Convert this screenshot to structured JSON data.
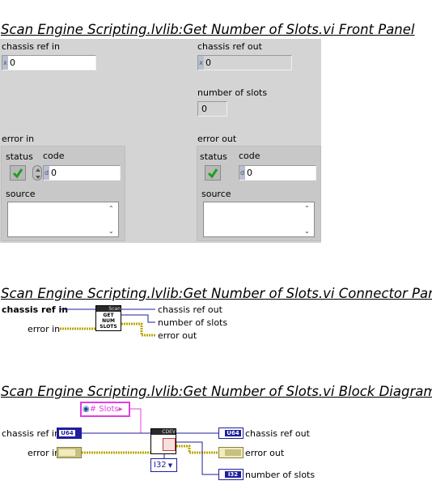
{
  "headings": {
    "front_panel": "Scan Engine Scripting.lvlib:Get Number of Slots.vi Front Panel",
    "connector_pane": "Scan Engine Scripting.lvlib:Get Number of Slots.vi Connector Pane",
    "block_diagram": "Scan Engine Scripting.lvlib:Get Number of Slots.vi Block Diagram"
  },
  "front_panel": {
    "chassis_ref_in": {
      "label": "chassis ref in",
      "radix": "x",
      "value": "0"
    },
    "chassis_ref_out": {
      "label": "chassis ref out",
      "radix": "x",
      "value": "0"
    },
    "number_of_slots": {
      "label": "number of slots",
      "value": "0"
    },
    "error_in": {
      "label": "error in",
      "status_label": "status",
      "code_label": "code",
      "code_value": "0",
      "code_radix": "d",
      "source_label": "source"
    },
    "error_out": {
      "label": "error out",
      "status_label": "status",
      "code_label": "code",
      "code_value": "0",
      "code_radix": "d",
      "source_label": "source"
    }
  },
  "connector_pane": {
    "chassis_ref_in": "chassis ref in",
    "error_in": "error in",
    "chassis_ref_out": "chassis ref out",
    "number_of_slots": "number of slots",
    "error_out": "error out",
    "icon_banner": "Scan",
    "icon_text": [
      "GET",
      "NUM",
      "SLOTS"
    ]
  },
  "block_diagram": {
    "property_constant": "# Slots",
    "chassis_ref_in": "chassis ref in",
    "error_in": "error in",
    "chassis_ref_out": "chassis ref out",
    "error_out": "error out",
    "number_of_slots": "number of slots",
    "u64_tag": "U64",
    "i32_tag": "I32",
    "type_selector": "I32",
    "subvi_banner": "CDEV"
  },
  "colors": {
    "panel_bg": "#d4d4d4",
    "refnum_wire": "#1e1e9e",
    "error_wire": "#b8a800",
    "integer_wire": "#1e1e9e",
    "property_pink": "#e040e0",
    "status_check": "#1fa01f"
  }
}
